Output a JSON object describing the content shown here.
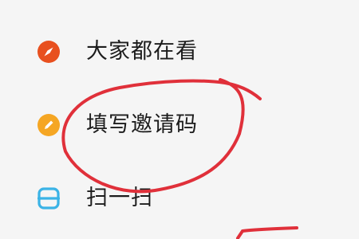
{
  "menu": {
    "items": [
      {
        "label": "大家都在看",
        "icon": "compass-icon",
        "icon_color": "#e8501f"
      },
      {
        "label": "填写邀请码",
        "icon": "pencil-icon",
        "icon_color": "#f5a623"
      },
      {
        "label": "扫一扫",
        "icon": "scan-icon",
        "icon_color": "#3bb3e6"
      }
    ]
  },
  "annotation_color": "#e0303a"
}
